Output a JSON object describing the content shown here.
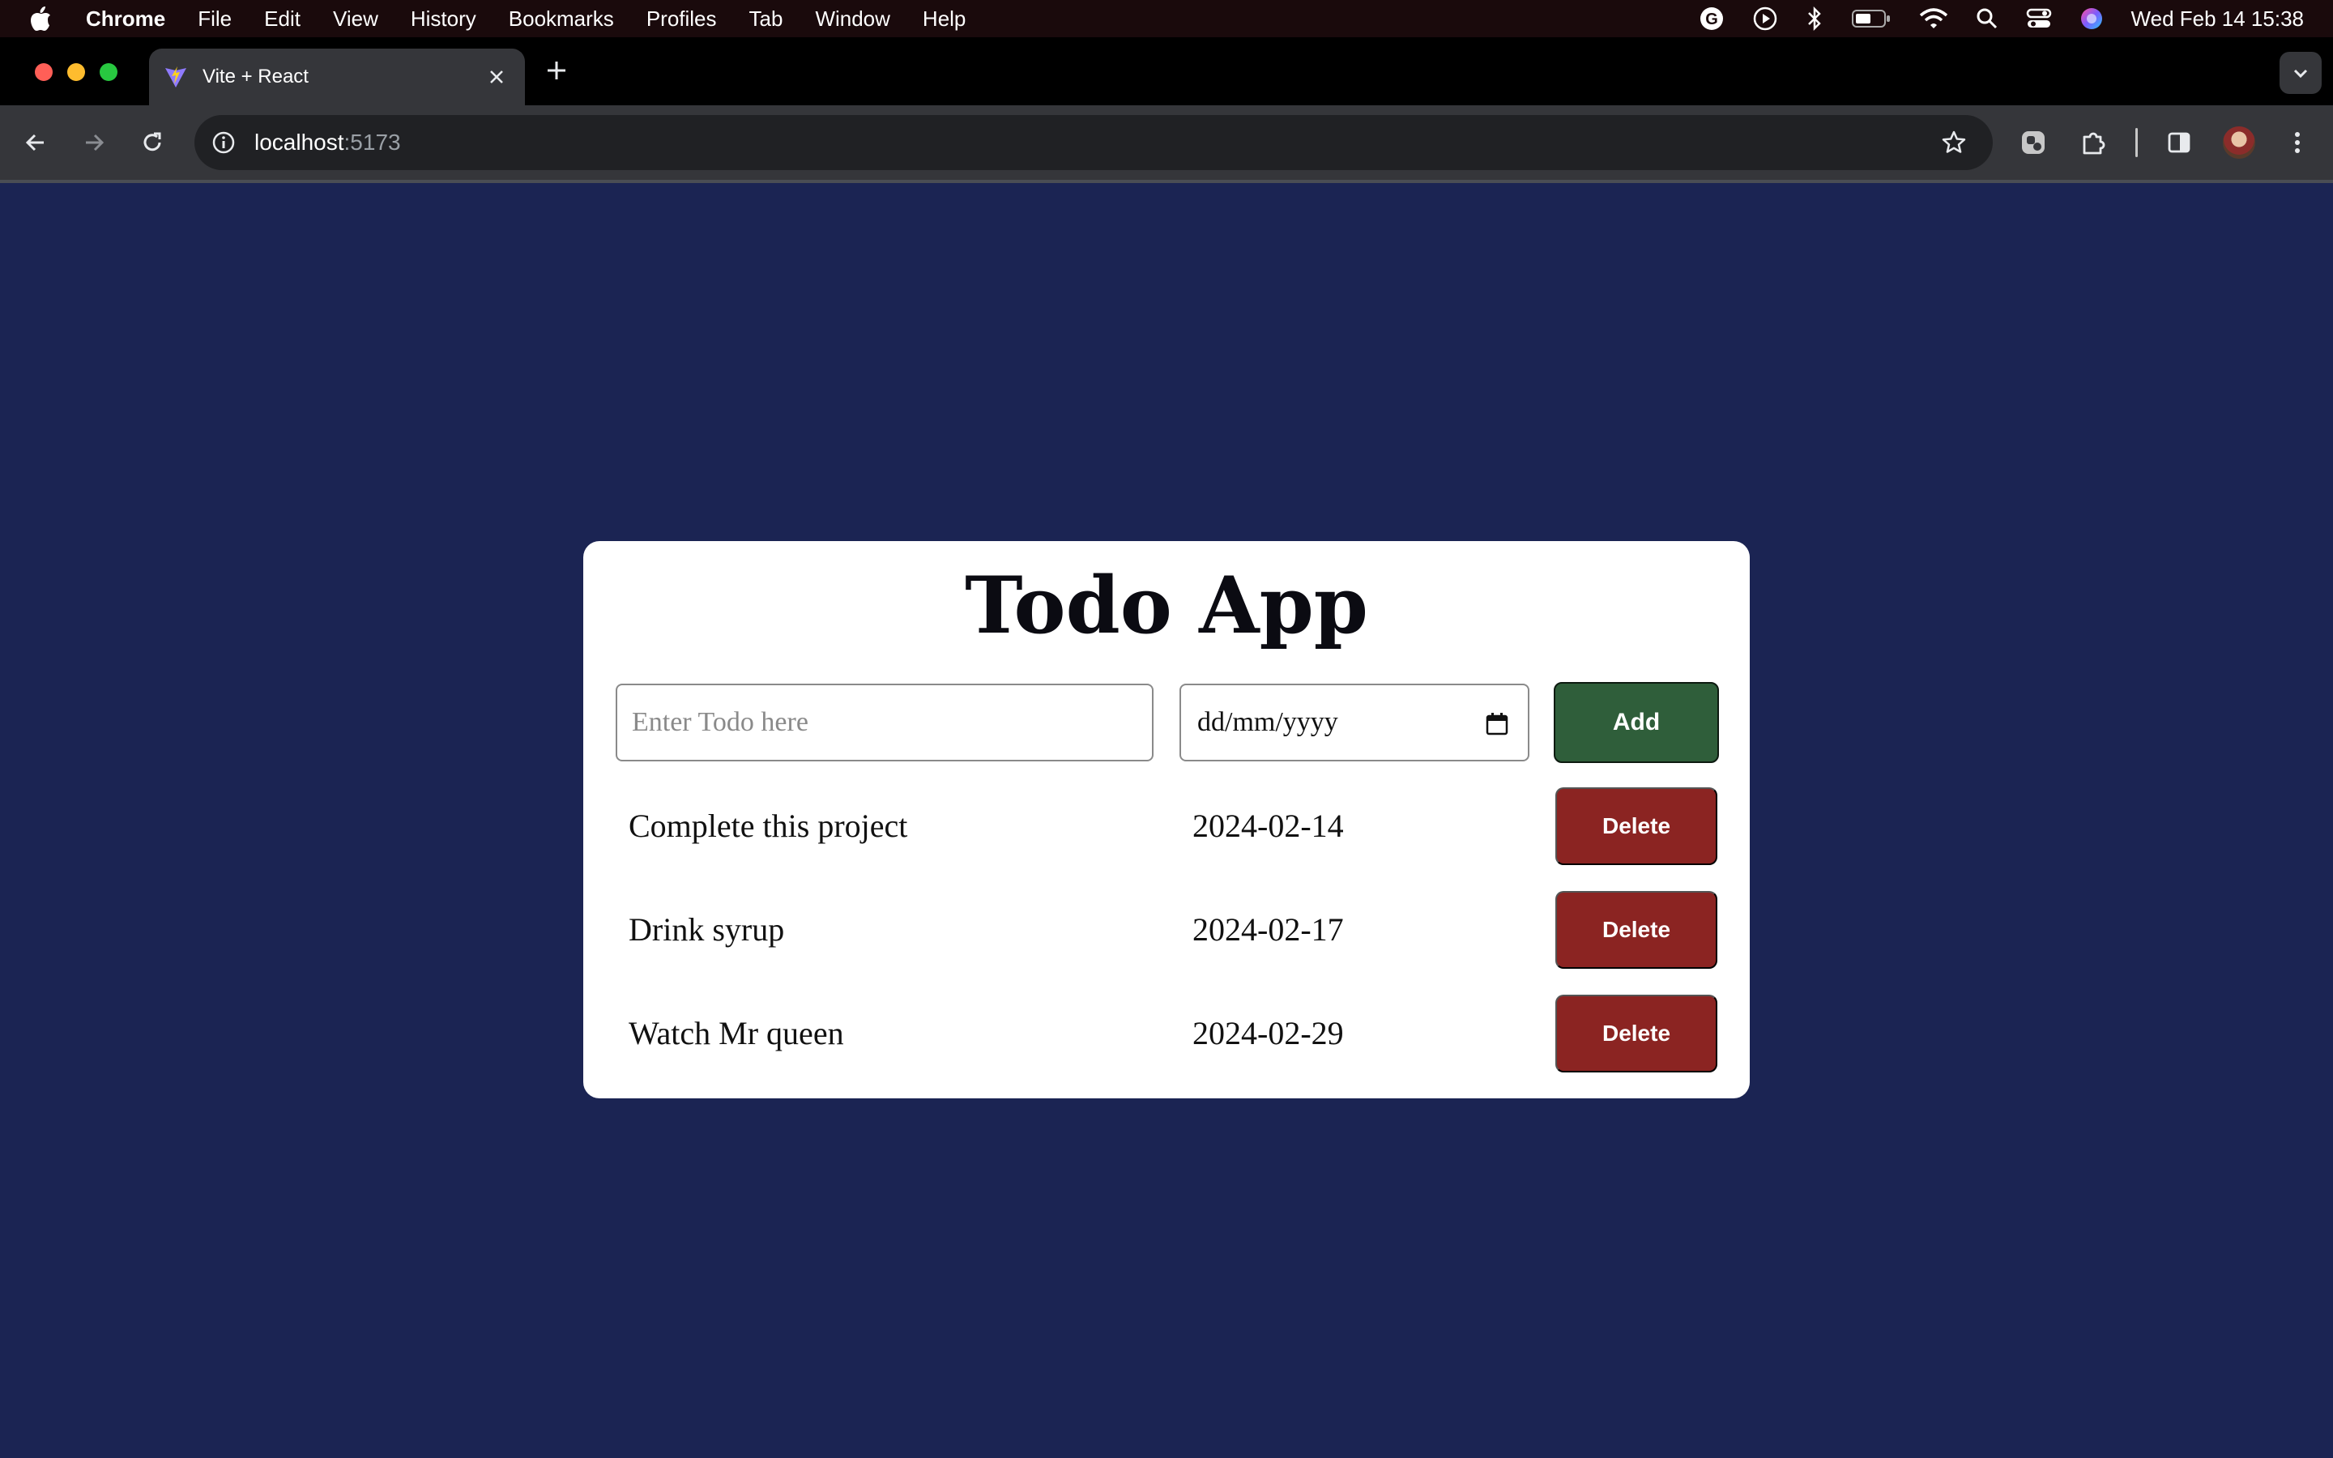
{
  "menubar": {
    "app_name": "Chrome",
    "menus": [
      "File",
      "Edit",
      "View",
      "History",
      "Bookmarks",
      "Profiles",
      "Tab",
      "Window",
      "Help"
    ],
    "clock": "Wed Feb 14  15:38"
  },
  "browser": {
    "tab_title": "Vite + React",
    "url_host": "localhost",
    "url_port": ":5173"
  },
  "app": {
    "title": "Todo App",
    "todo_placeholder": "Enter Todo here",
    "date_placeholder": "dd/mm/yyyy",
    "add_label": "Add",
    "delete_label": "Delete",
    "todos": [
      {
        "name": "Complete this project",
        "date": "2024-02-14"
      },
      {
        "name": "Drink syrup",
        "date": "2024-02-17"
      },
      {
        "name": "Watch Mr queen",
        "date": "2024-02-29"
      }
    ]
  },
  "colors": {
    "page_background": "#1b2453",
    "add_button": "#2f5e3a",
    "delete_button": "#8b2422"
  }
}
